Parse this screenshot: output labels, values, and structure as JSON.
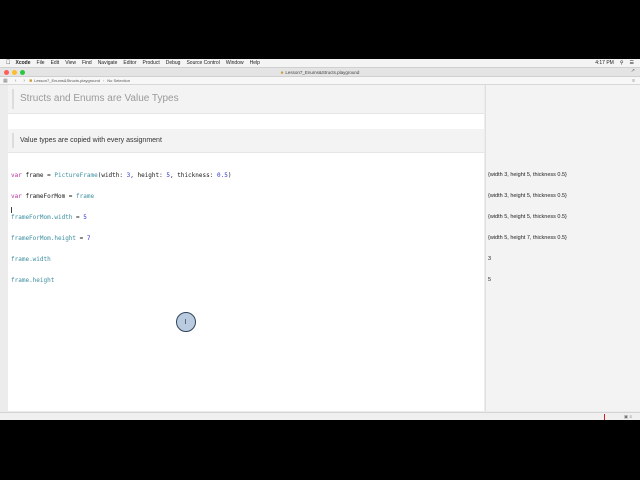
{
  "menubar": {
    "app": "Xcode",
    "items": [
      "File",
      "Edit",
      "View",
      "Find",
      "Navigate",
      "Editor",
      "Product",
      "Debug",
      "Source Control",
      "Window",
      "Help"
    ],
    "clock": "4:17 PM"
  },
  "window": {
    "title": "Lesson7_Enums&Structs.playground"
  },
  "jumpbar": {
    "file": "Lesson7_Enums&Structs.playground",
    "selection": "No Selection"
  },
  "markdown": {
    "heading": "Structs and Enums are Value Types",
    "paragraph": "Value types are copied with every assignment"
  },
  "code": {
    "line1": {
      "kw": "var",
      "name": " frame = ",
      "type": "PictureFrame",
      "a": "(width: ",
      "n1": "3",
      "b": ", height: ",
      "n2": "5",
      "c": ", thickness: ",
      "n3": "0.5",
      "d": ")"
    },
    "line2": {
      "kw": "var",
      "name": " frameForMom = ",
      "ref": "frame"
    },
    "line3": {
      "ref": "frameForMom",
      "prop": ".width",
      "eq": " = ",
      "n": "5"
    },
    "line4": {
      "ref": "frameForMom",
      "prop": ".height",
      "eq": " = ",
      "n": "7"
    },
    "line5": {
      "ref": "frame",
      "prop": ".width"
    },
    "line6": {
      "ref": "frame",
      "prop": ".height"
    }
  },
  "results": [
    "{width 3, height 5, thickness 0.5}",
    "{width 3, height 5, thickness 0.5}",
    "{width 5, height 5, thickness 0.5}",
    "{width 5, height 7, thickness 0.5}",
    "3",
    "5"
  ],
  "colors": {
    "keyword": "#b8329c",
    "type": "#3d8fa0",
    "number": "#2d33d0",
    "close": "#fc5f57",
    "minimize": "#fdbc2e",
    "zoom": "#28c840"
  }
}
